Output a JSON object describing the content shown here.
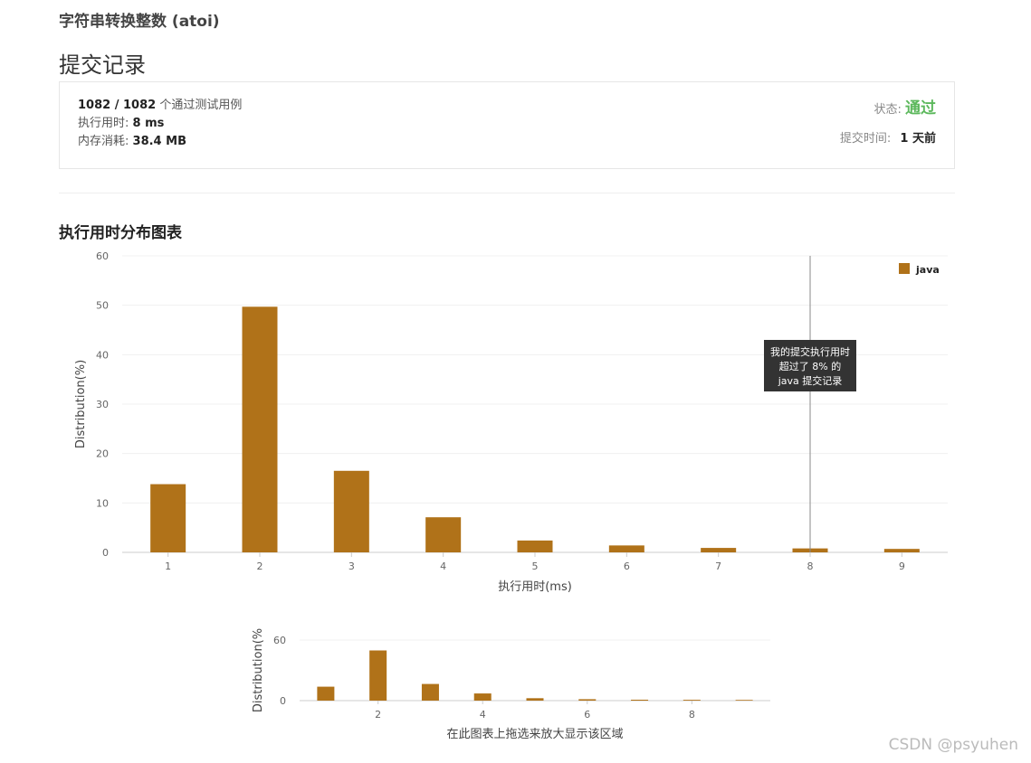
{
  "header": {
    "problem_title": "字符串转换整数 (atoi)",
    "page_title": "提交记录"
  },
  "summary": {
    "passed": "1082 / 1082",
    "passed_suffix": "个通过测试用例",
    "runtime_label": "执行用时:",
    "runtime_value": "8 ms",
    "memory_label": "内存消耗:",
    "memory_value": "38.4 MB",
    "status_label": "状态:",
    "status_value": "通过",
    "status_color": "#5cb85c",
    "submit_time_label": "提交时间:",
    "submit_time_value": "1 天前"
  },
  "section_title": "执行用时分布图表",
  "chart_data": [
    {
      "type": "bar",
      "categories": [
        "1",
        "2",
        "3",
        "4",
        "5",
        "6",
        "7",
        "8",
        "9"
      ],
      "series": [
        {
          "name": "java",
          "values": [
            13.8,
            49.7,
            16.5,
            7.1,
            2.4,
            1.4,
            0.9,
            0.8,
            0.7
          ]
        }
      ],
      "xlabel": "执行用时(ms)",
      "ylabel": "Distribution(%)",
      "ylim": [
        0,
        60
      ],
      "yticks": [
        0,
        10,
        20,
        30,
        40,
        50,
        60
      ],
      "grid": true,
      "legend": "top-right",
      "color": "#b07219",
      "marker_x": 8,
      "tooltip": [
        "我的提交执行用时",
        "超过了 8% 的",
        "java 提交记录"
      ]
    },
    {
      "type": "bar",
      "categories": [
        "1",
        "2",
        "3",
        "4",
        "5",
        "6",
        "7",
        "8",
        "9"
      ],
      "series": [
        {
          "values": [
            13.8,
            49.7,
            16.5,
            7.1,
            2.4,
            1.4,
            0.9,
            0.8,
            0.7
          ]
        }
      ],
      "xticks": [
        "2",
        "4",
        "6",
        "8"
      ],
      "xlabel": "在此图表上拖选来放大显示该区域",
      "ylabel": "Distribution(%",
      "ylim": [
        0,
        60
      ],
      "yticks": [
        0,
        60
      ],
      "grid": true,
      "color": "#b07219"
    }
  ],
  "watermark": "CSDN @psyuhen"
}
